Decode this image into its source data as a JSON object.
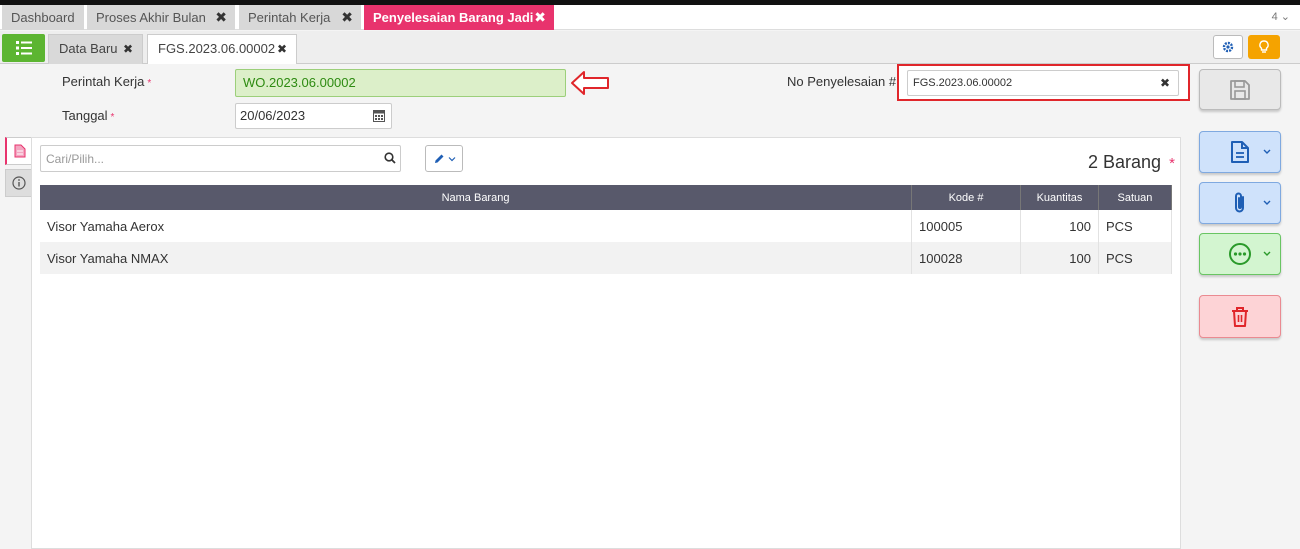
{
  "tabs": [
    {
      "label": "Dashboard",
      "closable": false,
      "active": false
    },
    {
      "label": "Proses Akhir Bulan",
      "closable": true,
      "active": false
    },
    {
      "label": "Perintah Kerja",
      "closable": true,
      "active": false
    },
    {
      "label": "Penyelesaian Barang Jadi",
      "closable": true,
      "active": true
    }
  ],
  "tab_count": "4",
  "subtabs": [
    {
      "label": "Data Baru"
    },
    {
      "label": "FGS.2023.06.00002"
    }
  ],
  "form": {
    "perintah_kerja_label": "Perintah Kerja",
    "perintah_kerja_value": "WO.2023.06.00002",
    "tanggal_label": "Tanggal",
    "tanggal_value": "20/06/2023",
    "no_label": "No Penyelesaian #",
    "no_value": "FGS.2023.06.00002",
    "required_mark": "*"
  },
  "items": {
    "search_placeholder": "Cari/Pilih...",
    "count_label": "2 Barang",
    "columns": [
      "Nama Barang",
      "Kode #",
      "Kuantitas",
      "Satuan"
    ],
    "rows": [
      {
        "name": "Visor Yamaha Aerox",
        "code": "100005",
        "qty": "100",
        "unit": "PCS"
      },
      {
        "name": "Visor Yamaha NMAX",
        "code": "100028",
        "qty": "100",
        "unit": "PCS"
      }
    ]
  },
  "icons": {
    "menu": "list-icon",
    "settings": "gear-icon",
    "tips": "lightbulb-icon",
    "save": "save-icon",
    "document": "document-icon",
    "attach": "paperclip-icon",
    "more": "more-icon",
    "delete": "trash-icon"
  },
  "colors": {
    "accent": "#e8336d",
    "menu_green": "#5cb531",
    "bulb": "#f5a300",
    "highlight_red": "#e0262b",
    "header_dark": "#58596b"
  }
}
